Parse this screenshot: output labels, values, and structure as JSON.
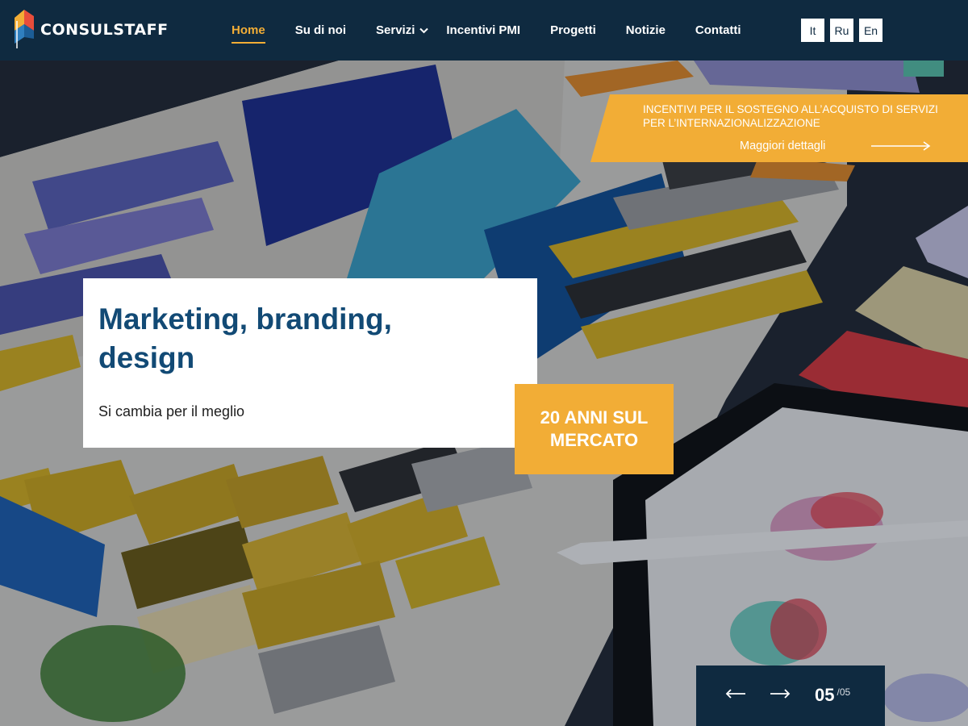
{
  "brand": {
    "name": "CONSULSTAFF"
  },
  "colors": {
    "header_bg": "#0f2a40",
    "accent": "#f2ad36",
    "title_blue": "#124a75"
  },
  "nav": {
    "items": [
      {
        "label": "Home",
        "active": true
      },
      {
        "label": "Su di noi"
      },
      {
        "label": "Servizi",
        "dropdown": true
      },
      {
        "label": "Incentivi PMI"
      },
      {
        "label": "Progetti"
      },
      {
        "label": "Notizie"
      },
      {
        "label": "Contatti"
      }
    ]
  },
  "languages": [
    "It",
    "Ru",
    "En"
  ],
  "promo": {
    "title": "INCENTIVI PER IL SOSTEGNO ALL’ACQUISTO DI SERVIZI PER L’INTERNAZIONALIZZAZIONE",
    "link": "Maggiori dettagli",
    "icon": "arrow-right-icon"
  },
  "slide": {
    "title": "Marketing, branding, design",
    "subtitle": "Si cambia per il meglio"
  },
  "badge": {
    "text": "20 ANNI SUL MERCATO"
  },
  "slider": {
    "current": "05",
    "total": "/05",
    "prev_icon": "arrow-left-icon",
    "next_icon": "arrow-right-icon"
  }
}
